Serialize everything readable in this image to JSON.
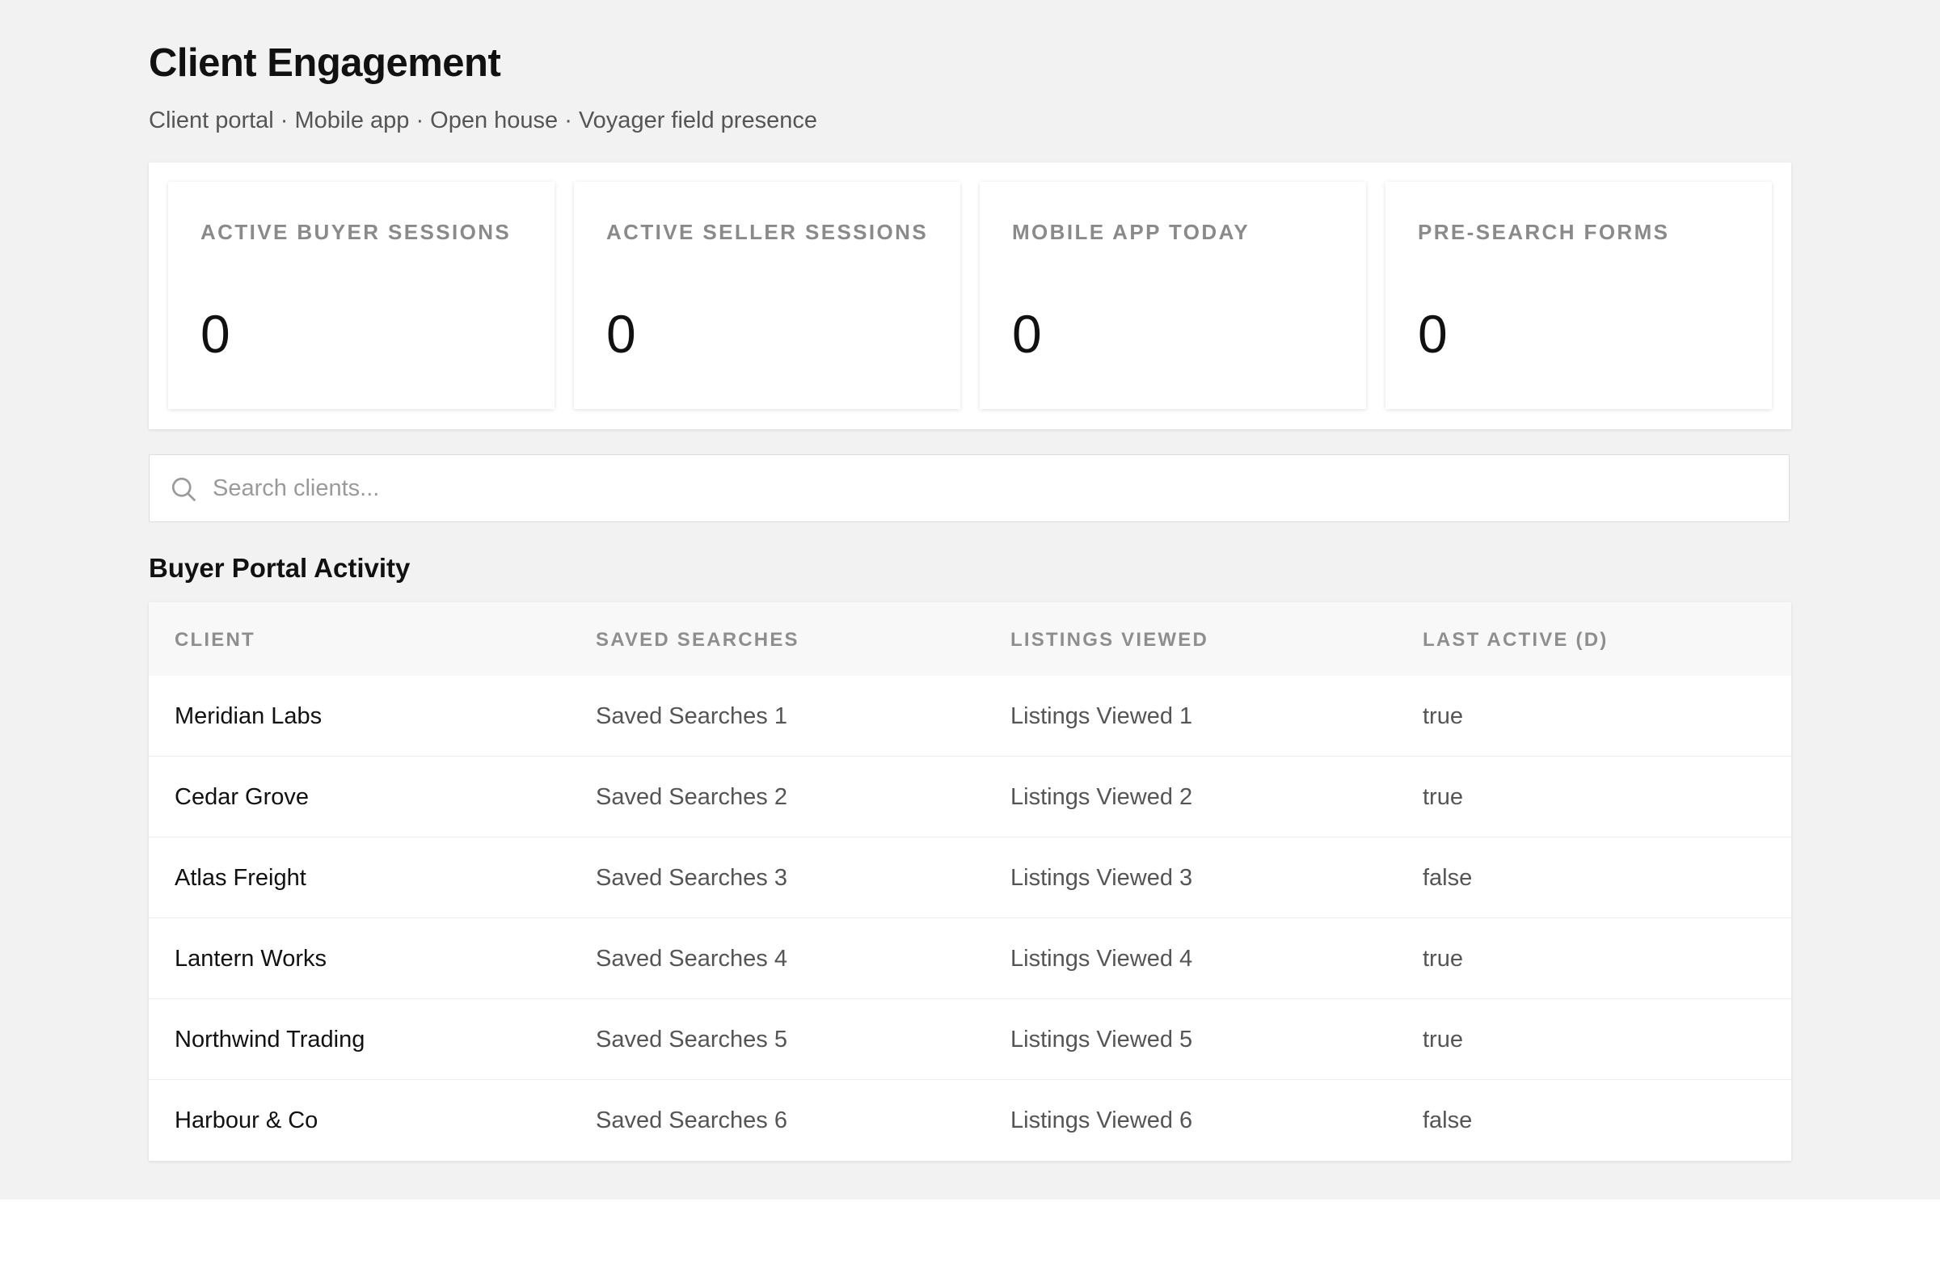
{
  "header": {
    "title": "Client Engagement",
    "subtitle": "Client portal · Mobile app · Open house · Voyager field presence"
  },
  "stats": [
    {
      "label": "ACTIVE BUYER SESSIONS",
      "value": "0"
    },
    {
      "label": "ACTIVE SELLER SESSIONS",
      "value": "0"
    },
    {
      "label": "MOBILE APP TODAY",
      "value": "0"
    },
    {
      "label": "PRE-SEARCH FORMS",
      "value": "0"
    }
  ],
  "search": {
    "placeholder": "Search clients...",
    "value": "",
    "icon": "search-icon"
  },
  "buyer_portal": {
    "title": "Buyer Portal Activity",
    "columns": [
      "CLIENT",
      "SAVED SEARCHES",
      "LISTINGS VIEWED",
      "LAST ACTIVE (D)"
    ],
    "rows": [
      {
        "client": "Meridian Labs",
        "saved_searches": "Saved Searches 1",
        "listings_viewed": "Listings Viewed 1",
        "last_active": "true"
      },
      {
        "client": "Cedar Grove",
        "saved_searches": "Saved Searches 2",
        "listings_viewed": "Listings Viewed 2",
        "last_active": "true"
      },
      {
        "client": "Atlas Freight",
        "saved_searches": "Saved Searches 3",
        "listings_viewed": "Listings Viewed 3",
        "last_active": "false"
      },
      {
        "client": "Lantern Works",
        "saved_searches": "Saved Searches 4",
        "listings_viewed": "Listings Viewed 4",
        "last_active": "true"
      },
      {
        "client": "Northwind Trading",
        "saved_searches": "Saved Searches 5",
        "listings_viewed": "Listings Viewed 5",
        "last_active": "true"
      },
      {
        "client": "Harbour & Co",
        "saved_searches": "Saved Searches 6",
        "listings_viewed": "Listings Viewed 6",
        "last_active": "false"
      }
    ]
  }
}
